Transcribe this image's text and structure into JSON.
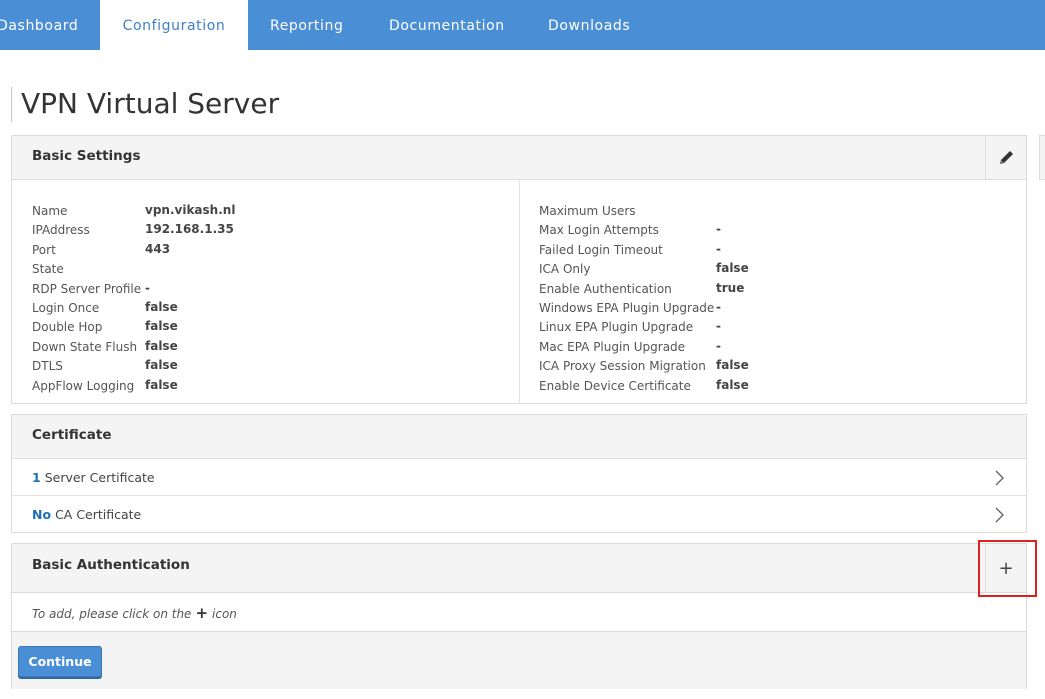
{
  "nav": {
    "tabs": [
      {
        "label": "Dashboard"
      },
      {
        "label": "Configuration",
        "active": true
      },
      {
        "label": "Reporting"
      },
      {
        "label": "Documentation"
      },
      {
        "label": "Downloads"
      }
    ]
  },
  "page": {
    "title": "VPN Virtual Server"
  },
  "basic_settings": {
    "title": "Basic Settings",
    "edit_icon": "pencil-icon",
    "left": [
      {
        "label": "Name",
        "value": "vpn.vikash.nl"
      },
      {
        "label": "IPAddress",
        "value": "192.168.1.35"
      },
      {
        "label": "Port",
        "value": "443"
      },
      {
        "label": "State",
        "value": ""
      },
      {
        "label": "RDP Server Profile",
        "value": "-"
      },
      {
        "label": "Login Once",
        "value": "false"
      },
      {
        "label": "Double Hop",
        "value": "false"
      },
      {
        "label": "Down State Flush",
        "value": "false"
      },
      {
        "label": "DTLS",
        "value": "false"
      },
      {
        "label": "AppFlow Logging",
        "value": "false"
      }
    ],
    "right": [
      {
        "label": "Maximum Users",
        "value": ""
      },
      {
        "label": "Max Login Attempts",
        "value": "-"
      },
      {
        "label": "Failed Login Timeout",
        "value": "-"
      },
      {
        "label": "ICA Only",
        "value": "false"
      },
      {
        "label": "Enable Authentication",
        "value": "true"
      },
      {
        "label": "Windows EPA Plugin Upgrade",
        "value": "-"
      },
      {
        "label": "Linux EPA Plugin Upgrade",
        "value": "-"
      },
      {
        "label": "Mac EPA Plugin Upgrade",
        "value": "-"
      },
      {
        "label": "ICA Proxy Session Migration",
        "value": "false"
      },
      {
        "label": "Enable Device Certificate",
        "value": "false"
      }
    ]
  },
  "certificate": {
    "title": "Certificate",
    "rows": [
      {
        "count": "1",
        "label": "Server Certificate"
      },
      {
        "count": "No",
        "label": "CA Certificate"
      }
    ]
  },
  "basic_auth": {
    "title": "Basic Authentication",
    "add_label": "+",
    "hint_before": "To add, please click on the",
    "hint_plus": "+",
    "hint_after": "icon",
    "continue_label": "Continue"
  },
  "colors": {
    "nav_bg": "#4a8fd6",
    "accent": "#1f6fb5",
    "highlight": "#e02020"
  }
}
